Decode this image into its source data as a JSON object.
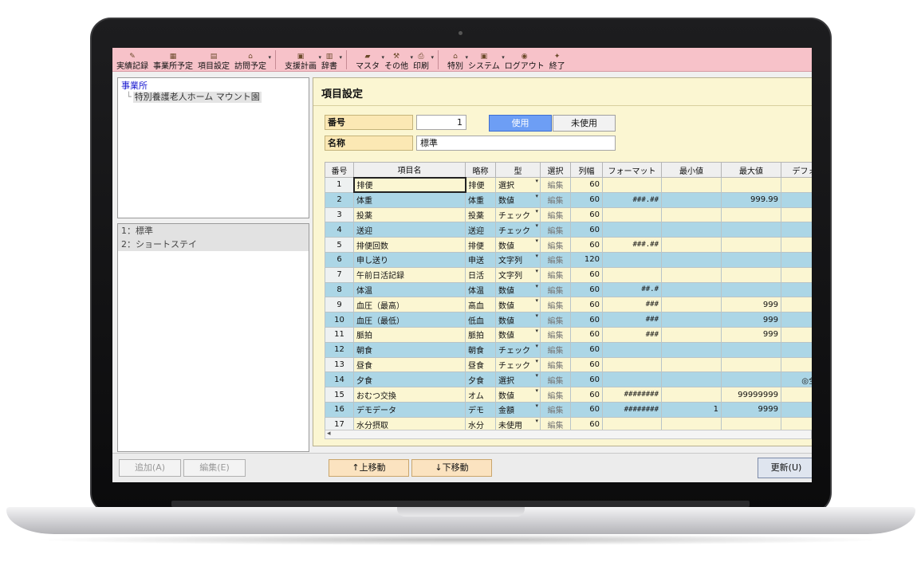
{
  "toolbar": {
    "group1": [
      {
        "label": "実績記録",
        "icon": "pencil-icon",
        "glyph": "✎",
        "caret": false
      },
      {
        "label": "事業所予定",
        "icon": "calendar-icon",
        "glyph": "▦",
        "caret": false
      },
      {
        "label": "項目設定",
        "icon": "settings-icon",
        "glyph": "▤",
        "caret": false
      },
      {
        "label": "訪問予定",
        "icon": "house-icon",
        "glyph": "⌂",
        "caret": true
      }
    ],
    "group2": [
      {
        "label": "支援計画",
        "icon": "monitor-icon",
        "glyph": "▣",
        "caret": true
      },
      {
        "label": "辞書",
        "icon": "book-icon",
        "glyph": "▥",
        "caret": true
      }
    ],
    "group3": [
      {
        "label": "マスタ",
        "icon": "folder-icon",
        "glyph": "▰",
        "caret": true
      },
      {
        "label": "その他",
        "icon": "tools-icon",
        "glyph": "⚒",
        "caret": true
      },
      {
        "label": "印刷",
        "icon": "printer-icon",
        "glyph": "⎙",
        "caret": true
      }
    ],
    "group4": [
      {
        "label": "特別",
        "icon": "building-icon",
        "glyph": "⌂",
        "caret": true
      },
      {
        "label": "システム",
        "icon": "computer-icon",
        "glyph": "▣",
        "caret": true
      },
      {
        "label": "ログアウト",
        "icon": "logout-icon",
        "glyph": "◉",
        "caret": false
      },
      {
        "label": "終了",
        "icon": "exit-icon",
        "glyph": "✦",
        "caret": false
      }
    ]
  },
  "tree": {
    "root": "事業所",
    "child": "特別養護老人ホーム マウント園"
  },
  "list": [
    "1：標準",
    "2：ショートステイ"
  ],
  "content": {
    "title": "項目設定",
    "number_label": "番号",
    "number_value": "1",
    "name_label": "名称",
    "name_value": "標準",
    "use_button": "使用",
    "unuse_button": "未使用"
  },
  "grid": {
    "headers": [
      "番号",
      "項目名",
      "略称",
      "型",
      "選択",
      "列幅",
      "フォーマット",
      "最小値",
      "最大値",
      "デフォル"
    ],
    "rows": [
      {
        "no": "1",
        "name": "排便",
        "abbr": "排便",
        "type": "選択",
        "edit": "編集",
        "width": "60",
        "format": "",
        "min": "",
        "max": "",
        "def": ""
      },
      {
        "no": "2",
        "name": "体重",
        "abbr": "体重",
        "type": "数値",
        "edit": "編集",
        "width": "60",
        "format": "###.##",
        "min": "",
        "max": "999.99",
        "def": ""
      },
      {
        "no": "3",
        "name": "投薬",
        "abbr": "投薬",
        "type": "チェック",
        "edit": "編集",
        "width": "60",
        "format": "",
        "min": "",
        "max": "",
        "def": ""
      },
      {
        "no": "4",
        "name": "送迎",
        "abbr": "送迎",
        "type": "チェック",
        "edit": "編集",
        "width": "60",
        "format": "",
        "min": "",
        "max": "",
        "def": "○"
      },
      {
        "no": "5",
        "name": "排便回数",
        "abbr": "排便",
        "type": "数値",
        "edit": "編集",
        "width": "60",
        "format": "###.##",
        "min": "",
        "max": "",
        "def": ""
      },
      {
        "no": "6",
        "name": "申し送り",
        "abbr": "申送",
        "type": "文字列",
        "edit": "編集",
        "width": "120",
        "format": "",
        "min": "",
        "max": "",
        "def": ""
      },
      {
        "no": "7",
        "name": "午前日活記録",
        "abbr": "日活",
        "type": "文字列",
        "edit": "編集",
        "width": "60",
        "format": "",
        "min": "",
        "max": "",
        "def": ""
      },
      {
        "no": "8",
        "name": "体温",
        "abbr": "体温",
        "type": "数値",
        "edit": "編集",
        "width": "60",
        "format": "##.#",
        "min": "",
        "max": "",
        "def": ""
      },
      {
        "no": "9",
        "name": "血圧（最高）",
        "abbr": "高血",
        "type": "数値",
        "edit": "編集",
        "width": "60",
        "format": "###",
        "min": "",
        "max": "999",
        "def": ""
      },
      {
        "no": "10",
        "name": "血圧（最低）",
        "abbr": "低血",
        "type": "数値",
        "edit": "編集",
        "width": "60",
        "format": "###",
        "min": "",
        "max": "999",
        "def": ""
      },
      {
        "no": "11",
        "name": "脈拍",
        "abbr": "脈拍",
        "type": "数値",
        "edit": "編集",
        "width": "60",
        "format": "###",
        "min": "",
        "max": "999",
        "def": ""
      },
      {
        "no": "12",
        "name": "朝食",
        "abbr": "朝食",
        "type": "チェック",
        "edit": "編集",
        "width": "60",
        "format": "",
        "min": "",
        "max": "",
        "def": "○"
      },
      {
        "no": "13",
        "name": "昼食",
        "abbr": "昼食",
        "type": "チェック",
        "edit": "編集",
        "width": "60",
        "format": "",
        "min": "",
        "max": "",
        "def": "○"
      },
      {
        "no": "14",
        "name": "夕食",
        "abbr": "夕食",
        "type": "選択",
        "edit": "編集",
        "width": "60",
        "format": "",
        "min": "",
        "max": "",
        "def": "◎全部食"
      },
      {
        "no": "15",
        "name": "おむつ交換",
        "abbr": "オム",
        "type": "数値",
        "edit": "編集",
        "width": "60",
        "format": "########",
        "min": "",
        "max": "99999999",
        "def": ""
      },
      {
        "no": "16",
        "name": "デモデータ",
        "abbr": "デモ",
        "type": "金額",
        "edit": "編集",
        "width": "60",
        "format": "########",
        "min": "1",
        "max": "9999",
        "def": ""
      },
      {
        "no": "17",
        "name": "水分摂取",
        "abbr": "水分",
        "type": "未使用",
        "edit": "編集",
        "width": "60",
        "format": "",
        "min": "",
        "max": "",
        "def": ""
      }
    ]
  },
  "buttons": {
    "add": "追加(A)",
    "edit": "編集(E)",
    "move_up": "↑上移動",
    "move_down": "↓下移動",
    "update": "更新(U)"
  }
}
